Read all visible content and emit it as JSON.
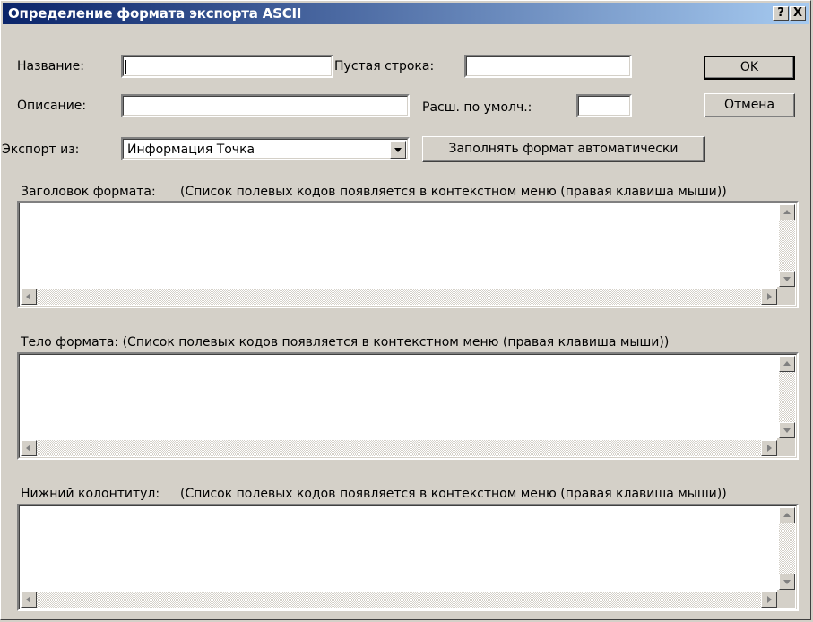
{
  "window": {
    "title": "Определение формата экспорта ASCII",
    "help_button": "?",
    "close_button": "X"
  },
  "fields": {
    "name_label": "Название:",
    "name_value": "",
    "empty_row_label": "Пустая строка:",
    "empty_row_value": "",
    "description_label": "Описание:",
    "description_value": "",
    "default_ext_label": "Расш. по умолч.:",
    "default_ext_value": "",
    "export_from_label": "Экспорт из:",
    "export_from_value": "Информация Точка"
  },
  "buttons": {
    "ok": "OK",
    "cancel": "Отмена",
    "auto_fill": "Заполнять формат автоматически"
  },
  "sections": {
    "header_label": "Заголовок формата:",
    "header_hint": "(Список полевых кодов появляется в контекстном меню (правая клавиша мыши))",
    "body_label": "Тело формата: (Список полевых кодов появляется в контекстном меню (правая клавиша мыши))",
    "footer_label": "Нижний колонтитул:",
    "footer_hint": "(Список полевых кодов появляется в контекстном меню (правая клавиша мыши))"
  }
}
